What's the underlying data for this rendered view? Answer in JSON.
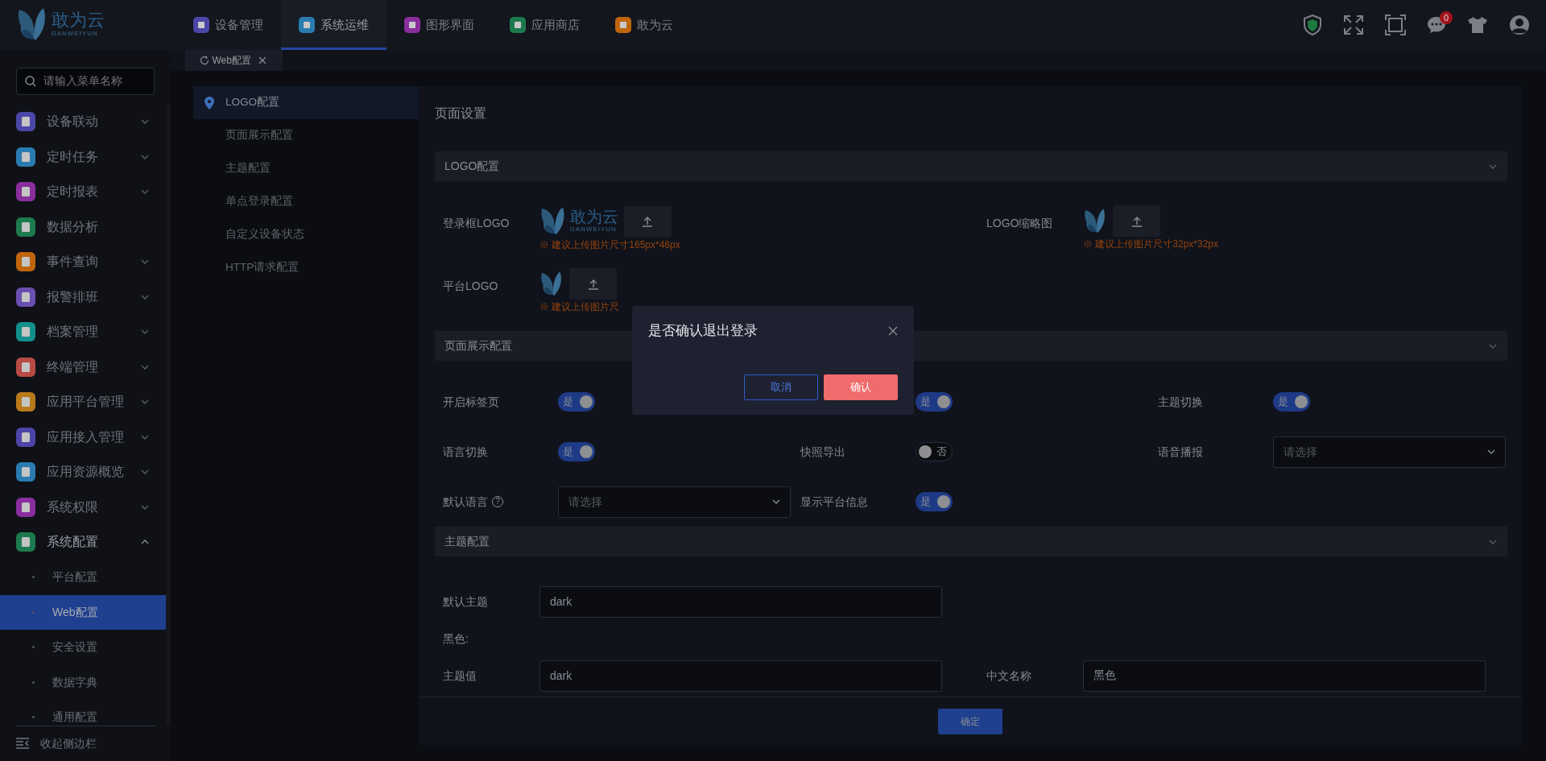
{
  "header": {
    "logo": {
      "name": "敢为云",
      "subtitle": "GANWEIYUN"
    },
    "tabs": [
      {
        "label": "设备管理",
        "color": "#4b47a8",
        "selected": false
      },
      {
        "label": "系统运维",
        "color": "#2a7cb0",
        "selected": true
      },
      {
        "label": "图形界面",
        "color": "#8a2e9e",
        "selected": false
      },
      {
        "label": "应用商店",
        "color": "#1d7a4e",
        "selected": false
      },
      {
        "label": "敢为云",
        "color": "#c0650c",
        "selected": false
      }
    ],
    "notifications": {
      "count": "0"
    }
  },
  "sidebar": {
    "search": {
      "placeholder": "请输入菜单名称"
    },
    "items": [
      {
        "label": "设备联动",
        "color": "#4b47a8",
        "expanded": false
      },
      {
        "label": "定时任务",
        "color": "#2a7cb0",
        "expanded": false
      },
      {
        "label": "定时报表",
        "color": "#8a2e9e",
        "expanded": false
      },
      {
        "label": "数据分析",
        "color": "#1d7a4e"
      },
      {
        "label": "事件查询",
        "color": "#c0650c",
        "expanded": false
      },
      {
        "label": "报警排班",
        "color": "#6a4fb0",
        "expanded": false
      },
      {
        "label": "档案管理",
        "color": "#138f8c",
        "expanded": false
      },
      {
        "label": "终端管理",
        "color": "#b84a44",
        "expanded": false
      },
      {
        "label": "应用平台管理",
        "color": "#b87a1a",
        "expanded": false
      },
      {
        "label": "应用接入管理",
        "color": "#4d44a8",
        "expanded": false
      },
      {
        "label": "应用资源概览",
        "color": "#2a7cb0",
        "expanded": false
      },
      {
        "label": "系统权限",
        "color": "#8a2e9e",
        "expanded": false
      },
      {
        "label": "系统配置",
        "color": "#1d7a4e",
        "expanded": true,
        "children": [
          {
            "label": "平台配置",
            "selected": false
          },
          {
            "label": "Web配置",
            "selected": true
          },
          {
            "label": "安全设置",
            "selected": false
          },
          {
            "label": "数据字典",
            "selected": false
          },
          {
            "label": "通用配置",
            "selected": false
          }
        ]
      }
    ],
    "collapse_label": "收起侧边栏"
  },
  "page_tabs": [
    {
      "label": "Web配置",
      "selected": true
    }
  ],
  "subnav": [
    {
      "label": "LOGO配置",
      "selected": true
    },
    {
      "label": "页面展示配置",
      "selected": false
    },
    {
      "label": "主题配置",
      "selected": false
    },
    {
      "label": "单点登录配置",
      "selected": false
    },
    {
      "label": "自定义设备状态",
      "selected": false
    },
    {
      "label": "HTTP请求配置",
      "selected": false
    }
  ],
  "panel": {
    "title": "页面设置",
    "submit": "确定",
    "sections": [
      {
        "title": "LOGO配置",
        "kind": "logos",
        "items": [
          {
            "label": "登录框LOGO",
            "logo_name": "敢为云",
            "logo_subtitle": "GANWEIYUN",
            "hint": "※ 建议上传图片尺寸165px*46px"
          },
          {
            "label": "LOGO缩略图",
            "hint": "※ 建议上传图片尺寸32px*32px"
          },
          {
            "label": "平台LOGO",
            "hint": "※ 建议上传图片尺"
          }
        ]
      },
      {
        "title": "页面展示配置",
        "kind": "grid3",
        "items": [
          {
            "kind": "switch",
            "label": "开启标签页",
            "on": true,
            "text": "是"
          },
          {
            "kind": "switch",
            "on": true,
            "text": "是"
          },
          {
            "kind": "switch",
            "label": "主题切换",
            "on": true,
            "text": "是"
          },
          {
            "kind": "switch",
            "label": "语言切换",
            "on": true,
            "text": "是"
          },
          {
            "kind": "switch",
            "label": "快照导出",
            "on": false,
            "text": "否"
          },
          {
            "kind": "select",
            "label": "语音播报",
            "placeholder": "请选择"
          },
          {
            "kind": "select",
            "label": "默认语言",
            "help": "?",
            "placeholder": "请选择"
          },
          {
            "kind": "switch",
            "label": "显示平台信息",
            "on": true,
            "text": "是"
          }
        ]
      },
      {
        "title": "主题配置",
        "kind": "grid2",
        "items": [
          {
            "kind": "input",
            "label": "默认主题",
            "value": "dark"
          },
          {
            "kind": "heading",
            "label": "黑色:"
          },
          {
            "kind": "input",
            "label": "主题值",
            "value": "dark"
          },
          {
            "kind": "input",
            "label": "中文名称",
            "value": "黑色"
          }
        ]
      }
    ]
  },
  "dialog": {
    "title": "是否确认退出登录",
    "cancel": "取消",
    "confirm": "确认"
  }
}
